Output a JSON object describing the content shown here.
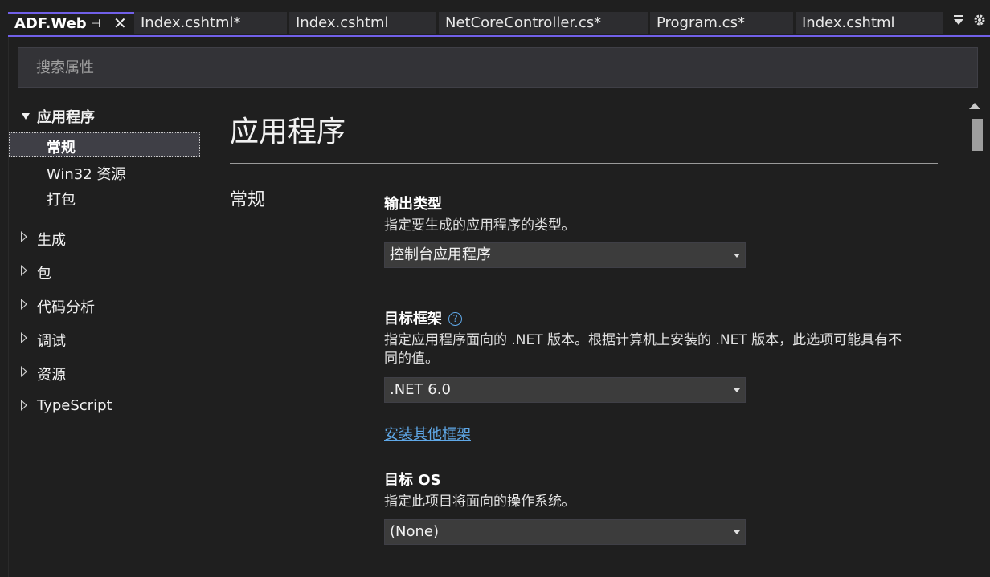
{
  "tabs": [
    {
      "label": "ADF.Web",
      "active": true
    },
    {
      "label": "Index.cshtml*"
    },
    {
      "label": "Index.cshtml"
    },
    {
      "label": "NetCoreController.cs*"
    },
    {
      "label": "Program.cs*"
    },
    {
      "label": "Index.cshtml"
    }
  ],
  "tab_icons": {
    "pin": "pin-icon",
    "close": "close-icon",
    "dropdown": "tab-list-dropdown-icon",
    "settings": "gear-icon"
  },
  "search": {
    "placeholder": "搜索属性"
  },
  "tree": {
    "application": {
      "label": "应用程序",
      "expanded": true,
      "children": [
        {
          "label": "常规",
          "selected": true
        },
        {
          "label": "Win32 资源"
        },
        {
          "label": "打包"
        }
      ]
    },
    "nodes": [
      {
        "label": "生成"
      },
      {
        "label": "包"
      },
      {
        "label": "代码分析"
      },
      {
        "label": "调试"
      },
      {
        "label": "资源"
      },
      {
        "label": "TypeScript"
      }
    ]
  },
  "content": {
    "title": "应用程序",
    "section": "常规",
    "output_type": {
      "label": "输出类型",
      "desc": "指定要生成的应用程序的类型。",
      "value": "控制台应用程序"
    },
    "target_framework": {
      "label": "目标框架",
      "desc_line1": "指定应用程序面向的 .NET 版本。根据计算机上安装的 .NET 版本，此选项可能具有不",
      "desc_line2": "同的值。",
      "value": ".NET 6.0",
      "help": "?"
    },
    "install_link": "安装其他框架",
    "target_os": {
      "label": "目标 OS",
      "desc": "指定此项目将面向的操作系统。",
      "value": "(None)"
    }
  },
  "colors": {
    "accent": "#7160e8",
    "link": "#5fa8e8",
    "background": "#1f1f1f"
  }
}
